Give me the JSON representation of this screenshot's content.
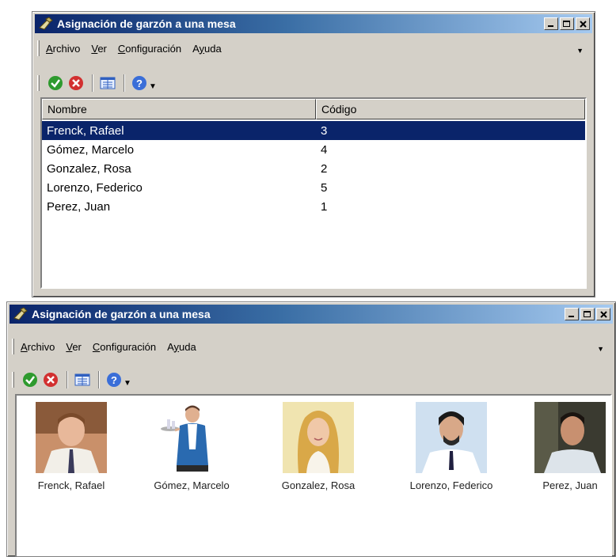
{
  "colors": {
    "titlebar_start": "#0a246a",
    "titlebar_end": "#a6caf0",
    "selection": "#0a246a",
    "chrome": "#d4d0c8"
  },
  "window_top": {
    "title": "Asignación de garzón a una mesa",
    "menu": [
      {
        "mnemonic": "A",
        "rest": "rchivo"
      },
      {
        "mnemonic": "V",
        "rest": "er"
      },
      {
        "mnemonic": "C",
        "rest": "onfiguración"
      },
      {
        "pre": "A",
        "mnemonic": "y",
        "rest": "uda"
      }
    ],
    "toolbar": [
      "accept-icon",
      "cancel-icon",
      "view-toggle-icon",
      "help-icon"
    ],
    "columns": [
      "Nombre",
      "Código"
    ],
    "rows": [
      {
        "name": "Frenck, Rafael",
        "code": "3",
        "selected": true
      },
      {
        "name": "Gómez, Marcelo",
        "code": "4"
      },
      {
        "name": "Gonzalez, Rosa",
        "code": "2"
      },
      {
        "name": "Lorenzo, Federico",
        "code": "5"
      },
      {
        "name": "Perez, Juan",
        "code": "1"
      }
    ]
  },
  "window_bottom": {
    "title": "Asignación de garzón a una mesa",
    "menu": [
      {
        "mnemonic": "A",
        "rest": "rchivo"
      },
      {
        "mnemonic": "V",
        "rest": "er"
      },
      {
        "mnemonic": "C",
        "rest": "onfiguración"
      },
      {
        "pre": "A",
        "mnemonic": "y",
        "rest": "uda"
      }
    ],
    "items": [
      {
        "name": "Frenck, Rafael"
      },
      {
        "name": "Gómez, Marcelo"
      },
      {
        "name": "Gonzalez, Rosa"
      },
      {
        "name": "Lorenzo, Federico"
      },
      {
        "name": "Perez, Juan"
      }
    ]
  }
}
